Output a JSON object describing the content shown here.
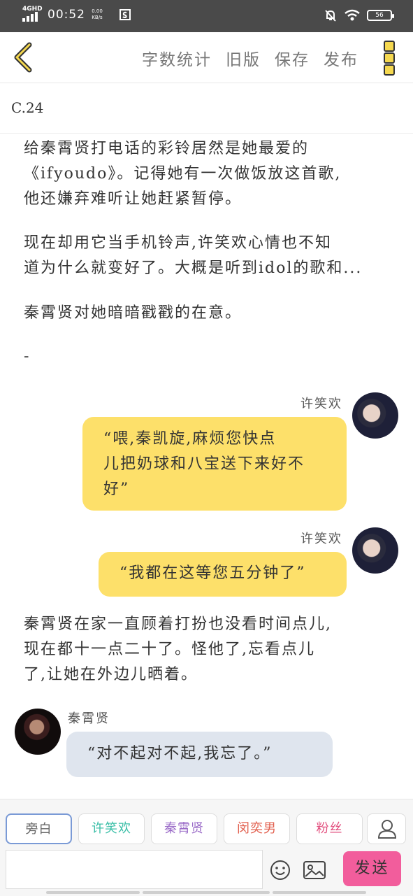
{
  "status_bar": {
    "network": "4GHD",
    "time": "00:52",
    "speed_value": "0.00",
    "speed_unit": "KB/s",
    "battery": "56"
  },
  "toolbar": {
    "menu": [
      "字数统计",
      "旧版",
      "保存",
      "发布"
    ]
  },
  "chapter_title": "C.24",
  "paragraphs": {
    "p1": [
      "给秦霄贤打电话的彩铃居然是她最爱的",
      "《ifyoudo》。记得她有一次做饭放这首歌,",
      "他还嫌弃难听让她赶紧暂停。"
    ],
    "p2": [
      "现在却用它当手机铃声,许笑欢心情也不知",
      "道为什么就变好了。大概是听到idol的歌和..."
    ],
    "p3": [
      "秦霄贤对她暗暗戳戳的在意。"
    ],
    "p4": [
      "-"
    ],
    "p5": [
      "秦霄贤在家一直顾着打扮也没看时间点儿,",
      "现在都十一点二十了。怪他了,忘看点儿",
      "了,让她在外边儿晒着。"
    ]
  },
  "messages": [
    {
      "speaker": "许笑欢",
      "lines": [
        "“喂,秦凯旋,麻烦您快点",
        "儿把奶球和八宝送下来好不",
        "好”"
      ]
    },
    {
      "speaker": "许笑欢",
      "lines": [
        "“我都在这等您五分钟了”"
      ]
    },
    {
      "speaker": "秦霄贤",
      "lines": [
        "“对不起对不起,我忘了。”"
      ]
    }
  ],
  "composer": {
    "roles": [
      "旁白",
      "许笑欢",
      "秦霄贤",
      "闵奕男",
      "粉丝",
      "从"
    ],
    "role_colors": [
      "#666666",
      "#3cbfa8",
      "#9b6cc8",
      "#e2604f",
      "#e2507f",
      "#e0a040"
    ],
    "input_value": "",
    "send_label": "发送"
  }
}
